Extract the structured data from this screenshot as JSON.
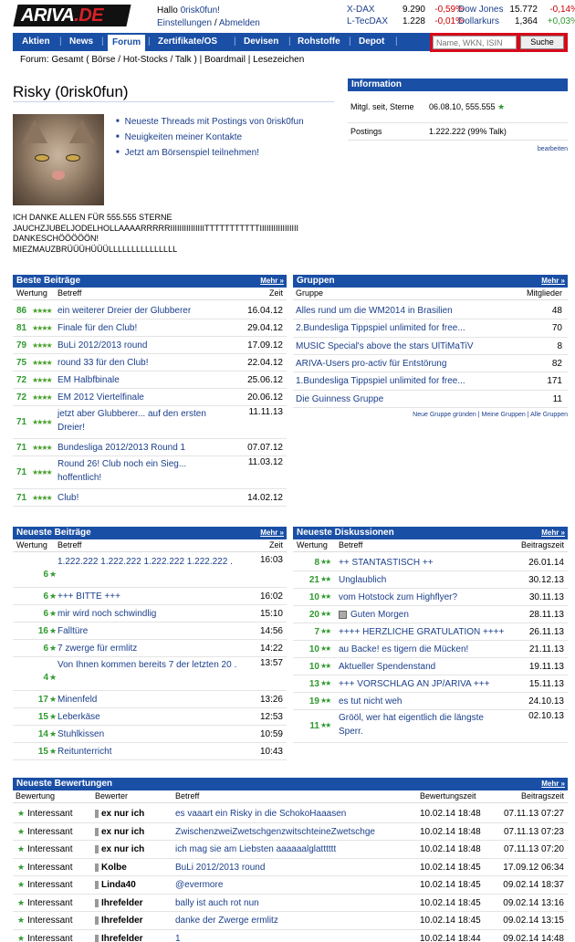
{
  "header": {
    "logo": {
      "main": "ARIVA",
      "suffix": ".DE"
    },
    "greeting": "Hallo ",
    "username": "0risk0fun!",
    "settings": "Einstellungen",
    "sep": " / ",
    "logout": "Abmelden"
  },
  "quotes": [
    {
      "name": "X-DAX",
      "value": "9.290",
      "change": "-0,59%"
    },
    {
      "name": "L-TecDAX",
      "value": "1.228",
      "change": "-0,01%"
    },
    {
      "name": "Dow Jones",
      "value": "15.772",
      "change": "-0,14%"
    },
    {
      "name": "Dollarkurs",
      "value": "1,364",
      "change": "+0,03%"
    }
  ],
  "nav": {
    "items": [
      "Aktien",
      "News",
      "Forum",
      "Zertifikate/OS",
      "Devisen",
      "Rohstoffe",
      "Depot"
    ],
    "active": "Forum",
    "search_placeholder": "Name, WKN, ISIN",
    "search_button": "Suche"
  },
  "subnav": {
    "label": "Forum: ",
    "items": [
      "Gesamt",
      "Börse",
      "Hot-Stocks",
      "Talk",
      "Boardmail",
      "Lesezeichen"
    ]
  },
  "profile": {
    "title": "Risky (0risk0fun)",
    "links": [
      "Neueste Threads mit Postings von 0risk0fun",
      "Neuigkeiten meiner Kontakte",
      "Jetzt am Börsenspiel teilnehmen!"
    ],
    "bio": "ICH DANKE ALLEN FÜR 555.555 STERNE\nJAUCHZJUBELJODELHOLLAAAARRRRRIIIIIIIIIIIIIIITTTTTTTTTTTIIIIIIIIIIIIIIIII\nDANKESCHÖÖÖÖÖN!\nMIEZMAUZBRÜÜÜHÜÜÜLLLLLLLLLLLLLLL"
  },
  "info": {
    "header": "Information",
    "rows": [
      {
        "label": "Mitgl. seit, Sterne",
        "value": "06.08.10, 555.555"
      },
      {
        "label": "Postings",
        "value": "1.222.222 (99% Talk)"
      }
    ],
    "edit": "bearbeiten"
  },
  "beste": {
    "header": "Beste Beiträge",
    "more": "Mehr »",
    "cols": [
      "Wertung",
      "Betreff",
      "Zeit"
    ],
    "rows": [
      {
        "score": "86",
        "subject": "ein weiterer Dreier der Glubberer",
        "date": "16.04.12"
      },
      {
        "score": "81",
        "subject": "Finale für den Club!",
        "date": "29.04.12"
      },
      {
        "score": "79",
        "subject": "BuLi 2012/2013 round",
        "date": "17.09.12"
      },
      {
        "score": "75",
        "subject": "round 33 für den Club!",
        "date": "22.04.12"
      },
      {
        "score": "72",
        "subject": "EM Halbfbinale",
        "date": "25.06.12"
      },
      {
        "score": "72",
        "subject": "EM 2012 Viertelfinale",
        "date": "20.06.12"
      },
      {
        "score": "71",
        "subject": "jetzt aber Glubberer... auf den ersten Dreier!",
        "date": "11.11.13"
      },
      {
        "score": "71",
        "subject": "Bundesliga 2012/2013 Round 1",
        "date": "07.07.12"
      },
      {
        "score": "71",
        "subject": "Round 26! Club noch ein Sieg... hoffentlich!",
        "date": "11.03.12"
      },
      {
        "score": "71",
        "subject": "Club!",
        "date": "14.02.12"
      }
    ]
  },
  "gruppen": {
    "header": "Gruppen",
    "more": "Mehr »",
    "cols": [
      "Gruppe",
      "Mitglieder"
    ],
    "rows": [
      {
        "name": "Alles rund um die WM2014 in Brasilien",
        "members": "48"
      },
      {
        "name": "2.Bundesliga Tippspiel unlimited for free...",
        "members": "70"
      },
      {
        "name": "MUSIC Special's above the stars UlTiMaTiV",
        "members": "8"
      },
      {
        "name": "ARIVA-Users pro-activ für Entstörung",
        "members": "82"
      },
      {
        "name": "1.Bundesliga Tippspiel unlimited for free...",
        "members": "171"
      },
      {
        "name": "Die Guinness Gruppe",
        "members": "11"
      }
    ],
    "footer": [
      "Neue Gruppe gründen",
      "Meine Gruppen",
      "Alle Gruppen"
    ]
  },
  "neueste_beitraege": {
    "header": "Neueste Beiträge",
    "more": "Mehr »",
    "cols": [
      "Wertung",
      "Betreff",
      "Zeit"
    ],
    "rows": [
      {
        "score": "6",
        "subject": "1.222.222 1.222.222 1.222.222 1.222.222 .",
        "time": "16:03"
      },
      {
        "score": "6",
        "subject": "+++ BITTE +++",
        "time": "16:02"
      },
      {
        "score": "6",
        "subject": "mir wird noch schwindlig",
        "time": "15:10"
      },
      {
        "score": "16",
        "subject": "Falltüre",
        "time": "14:56"
      },
      {
        "score": "6",
        "subject": "7 zwerge für ermlitz",
        "time": "14:22"
      },
      {
        "score": "4",
        "subject": "Von Ihnen kommen bereits 7 der letzten 20 .",
        "time": "13:57"
      },
      {
        "score": "17",
        "subject": "Minenfeld",
        "time": "13:26"
      },
      {
        "score": "15",
        "subject": "Leberkäse",
        "time": "12:53"
      },
      {
        "score": "14",
        "subject": "Stuhlkissen",
        "time": "10:59"
      },
      {
        "score": "15",
        "subject": "Reitunterricht",
        "time": "10:43"
      }
    ]
  },
  "neueste_diskussionen": {
    "header": "Neueste Diskussionen",
    "more": "Mehr »",
    "cols": [
      "Wertung",
      "Betreff",
      "Beitragszeit"
    ],
    "rows": [
      {
        "score": "8",
        "subject": "++ STANTASTISCH ++",
        "time": "26.01.14"
      },
      {
        "score": "21",
        "subject": "Unglaublich",
        "time": "30.12.13"
      },
      {
        "score": "10",
        "subject": "vom Hotstock zum Highflyer?",
        "time": "30.11.13"
      },
      {
        "score": "20",
        "subject": "Guten Morgen",
        "time": "28.11.13",
        "icon": true
      },
      {
        "score": "7",
        "subject": "++++ HERZLICHE GRATULATION ++++",
        "time": "26.11.13"
      },
      {
        "score": "10",
        "subject": "au Backe! es tigern die Mücken!",
        "time": "21.11.13"
      },
      {
        "score": "10",
        "subject": "Aktueller Spendenstand",
        "time": "19.11.13"
      },
      {
        "score": "13",
        "subject": "+++ VORSCHLAG AN JP/ARIVA +++",
        "time": "15.11.13"
      },
      {
        "score": "19",
        "subject": "es tut nicht weh",
        "time": "24.10.13"
      },
      {
        "score": "11",
        "subject": "Grööl, wer hat eigentlich die längste Sperr.",
        "time": "02.10.13"
      }
    ]
  },
  "bewertungen": {
    "header": "Neueste Bewertungen",
    "more": "Mehr »",
    "cols": [
      "Bewertung",
      "Bewerter",
      "Betreff",
      "Bewertungszeit",
      "Beitragszeit"
    ],
    "rows": [
      {
        "rating": "Interessant",
        "user": "ex nur ich",
        "subject": "es vaaart ein Risky in die SchokoHaaasen",
        "rtime": "10.02.14 18:48",
        "ptime": "07.11.13 07:27"
      },
      {
        "rating": "Interessant",
        "user": "ex nur ich",
        "subject": "ZwischenzweiZwetschgenzwitschteineZwetschge",
        "rtime": "10.02.14 18:48",
        "ptime": "07.11.13 07:23"
      },
      {
        "rating": "Interessant",
        "user": "ex nur ich",
        "subject": "ich mag sie am Liebsten aaaaaalglatttttt",
        "rtime": "10.02.14 18:48",
        "ptime": "07.11.13 07:20"
      },
      {
        "rating": "Interessant",
        "user": "Kolbe",
        "subject": "BuLi 2012/2013 round",
        "rtime": "10.02.14 18:45",
        "ptime": "17.09.12 06:34"
      },
      {
        "rating": "Interessant",
        "user": "Linda40",
        "subject": "@evermore",
        "rtime": "10.02.14 18:45",
        "ptime": "09.02.14 18:37"
      },
      {
        "rating": "Interessant",
        "user": "Ihrefelder",
        "subject": "bally ist auch rot nun",
        "rtime": "10.02.14 18:45",
        "ptime": "09.02.14 13:16"
      },
      {
        "rating": "Interessant",
        "user": "Ihrefelder",
        "subject": "danke der Zwerge ermlitz",
        "rtime": "10.02.14 18:45",
        "ptime": "09.02.14 13:15"
      },
      {
        "rating": "Interessant",
        "user": "Ihrefelder",
        "subject": "1",
        "rtime": "10.02.14 18:44",
        "ptime": "09.02.14 14:48"
      }
    ]
  },
  "colors": {
    "brand_blue": "#1a4fa6",
    "positive": "#2f9a2f",
    "negative": "#cc0000",
    "search_red": "#d60a1a"
  }
}
